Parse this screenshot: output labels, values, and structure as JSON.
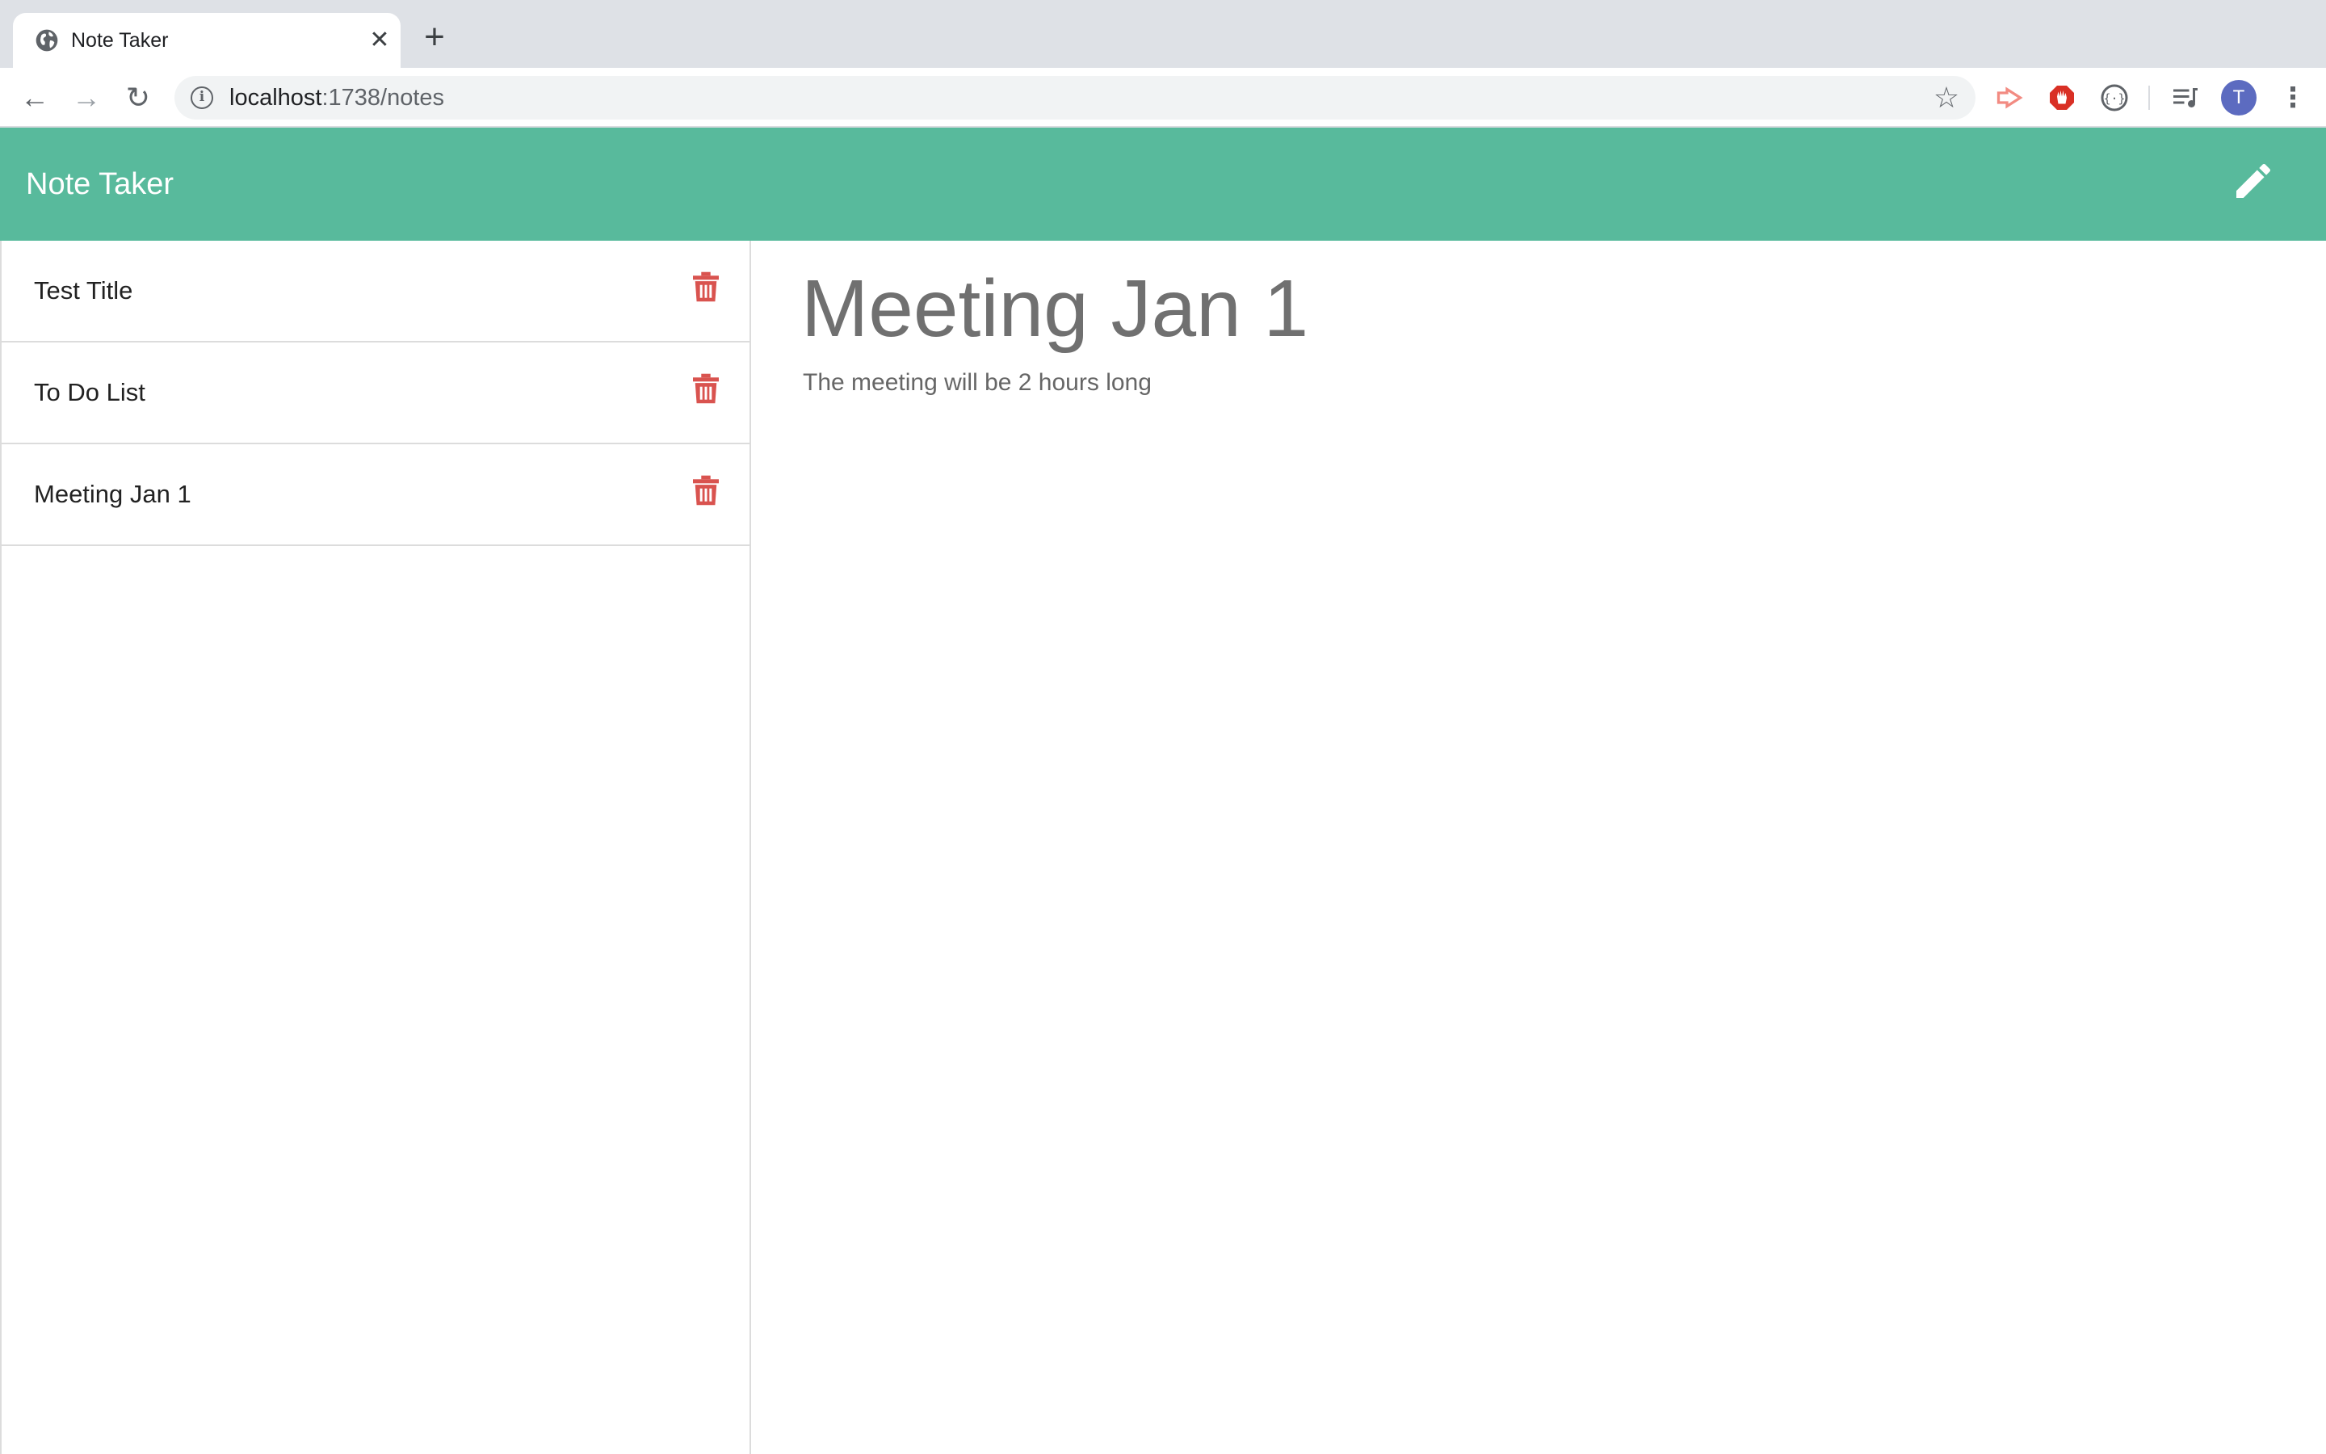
{
  "browser": {
    "tab": {
      "title": "Note Taker",
      "close_glyph": "✕"
    },
    "new_tab_glyph": "+",
    "nav": {
      "back_glyph": "←",
      "forward_glyph": "→",
      "reload_glyph": "↻"
    },
    "url": {
      "host": "localhost",
      "path": ":1738/notes"
    },
    "star_glyph": "☆",
    "profile_initial": "T",
    "menu_glyph": "⋮",
    "extensions": [
      "cast-icon",
      "adblock-icon",
      "code-braces-icon",
      "media-queue-icon"
    ]
  },
  "app": {
    "title": "Note Taker",
    "header_color": "#58ba9c",
    "accent_delete_color": "#d9534f",
    "new_note_icon": "pencil-icon"
  },
  "notes": [
    {
      "title": "Test Title"
    },
    {
      "title": "To Do List"
    },
    {
      "title": "Meeting Jan 1"
    }
  ],
  "active_note": {
    "title": "Meeting Jan 1",
    "text": "The meeting will be 2 hours long"
  }
}
